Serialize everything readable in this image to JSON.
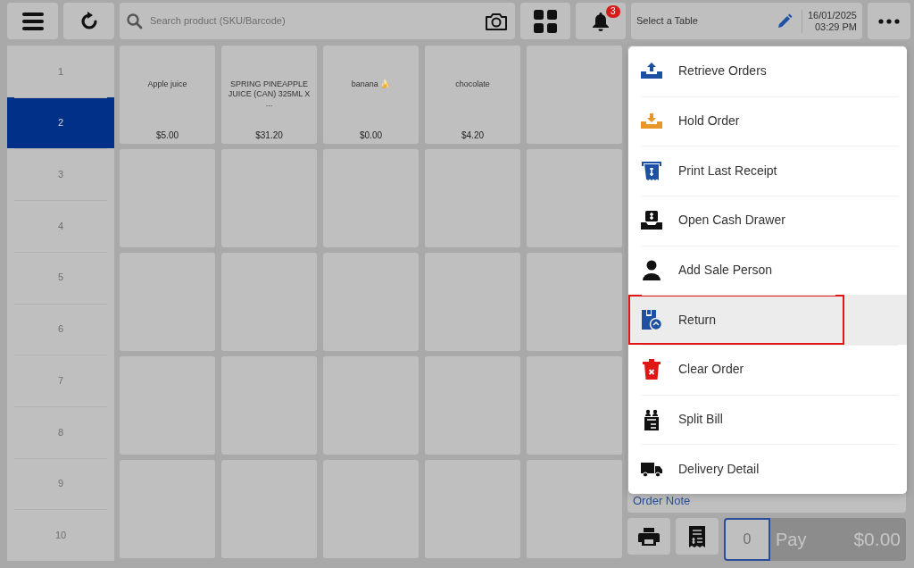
{
  "toolbar": {
    "search": {
      "placeholder": "Search product (SKU/Barcode)"
    },
    "notifications": {
      "count": "3"
    },
    "table": {
      "label": "Select a Table"
    },
    "date": "16/01/2025",
    "time": "03:29 PM"
  },
  "pages": [
    {
      "label": "1",
      "selected": false
    },
    {
      "label": "2",
      "selected": true
    },
    {
      "label": "3",
      "selected": false
    },
    {
      "label": "4",
      "selected": false
    },
    {
      "label": "5",
      "selected": false
    },
    {
      "label": "6",
      "selected": false
    },
    {
      "label": "7",
      "selected": false
    },
    {
      "label": "8",
      "selected": false
    },
    {
      "label": "9",
      "selected": false
    },
    {
      "label": "10",
      "selected": false
    }
  ],
  "products": [
    {
      "name": "Apple juice",
      "price": "$5.00"
    },
    {
      "name": "SPRING PINEAPPLE JUICE (CAN) 325ML X ...",
      "price": "$31.20"
    },
    {
      "name": "banana 🍌",
      "price": "$0.00"
    },
    {
      "name": "chocolate",
      "price": "$4.20"
    }
  ],
  "order_note": "Order Note",
  "footer": {
    "quantity": "0",
    "pay_label": "Pay",
    "total": "$0.00"
  },
  "menu": {
    "items": [
      {
        "label": "Retrieve Orders",
        "selected": false
      },
      {
        "label": "Hold Order",
        "selected": false
      },
      {
        "label": "Print Last Receipt",
        "selected": false
      },
      {
        "label": "Open Cash Drawer",
        "selected": false
      },
      {
        "label": "Add Sale Person",
        "selected": false
      },
      {
        "label": "Return",
        "selected": true
      },
      {
        "label": "Clear Order",
        "selected": false
      },
      {
        "label": "Split Bill",
        "selected": false
      },
      {
        "label": "Delivery Detail",
        "selected": false
      }
    ]
  }
}
